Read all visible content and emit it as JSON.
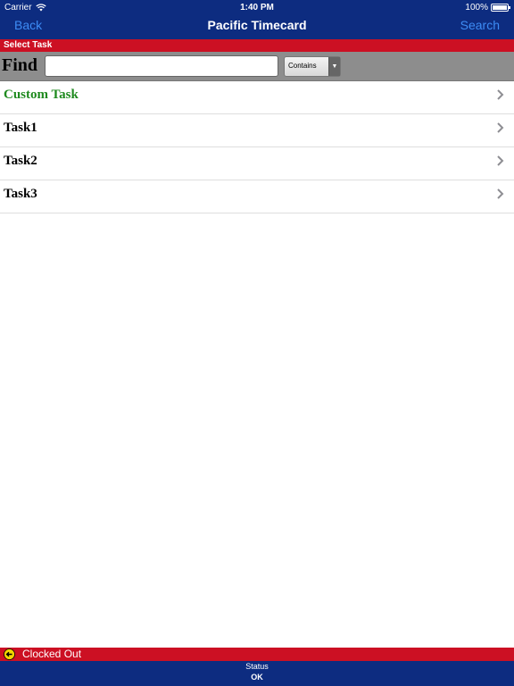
{
  "status_bar": {
    "carrier": "Carrier",
    "time": "1:40 PM",
    "battery": "100%"
  },
  "nav": {
    "back_label": "Back",
    "title": "Pacific Timecard",
    "search_label": "Search"
  },
  "section": {
    "title": "Select Task"
  },
  "find": {
    "label": "Find",
    "value": "",
    "placeholder": "",
    "match_mode": "Contains"
  },
  "tasks": [
    {
      "label": "Custom Task"
    },
    {
      "label": "Task1"
    },
    {
      "label": "Task2"
    },
    {
      "label": "Task3"
    }
  ],
  "clock_status": {
    "label": "Clocked Out"
  },
  "bottom": {
    "caption": "Status",
    "value": "OK"
  },
  "colors": {
    "nav_bg": "#0d2c80",
    "accent_red": "#cc1023",
    "link_blue": "#3d8cf5",
    "custom_task_green": "#1e8a1e"
  }
}
